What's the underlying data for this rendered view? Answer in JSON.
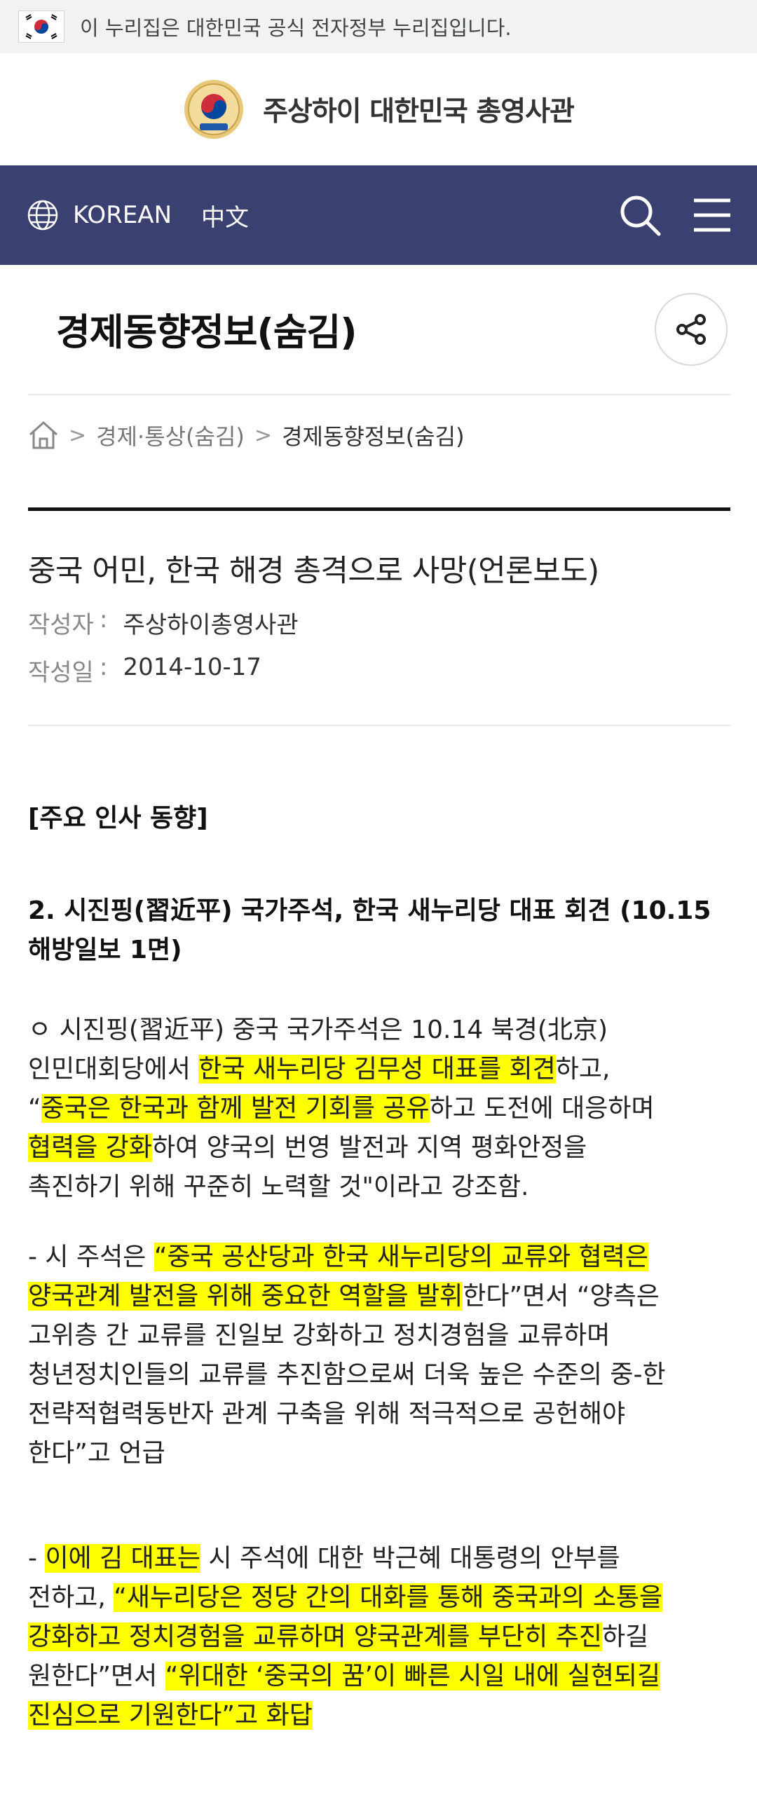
{
  "gov_banner": {
    "text": "이 누리집은 대한민국 공식 전자정부 누리집입니다."
  },
  "header": {
    "title": "주상하이 대한민국 총영사관"
  },
  "nav": {
    "lang_korean": "KOREAN",
    "lang_chinese": "中文"
  },
  "page": {
    "title": "경제동향정보(숨김)"
  },
  "breadcrumb": {
    "items": [
      "경제·통상(숨김)",
      "경제동향정보(숨김)"
    ]
  },
  "post": {
    "title": "중국 어민, 한국 해경 총격으로 사망(언론보도)",
    "author_label": "작성자",
    "author": "주상하이총영사관",
    "date_label": "작성일",
    "date": "2014-10-17"
  },
  "article": {
    "section": "[주요 인사 동향]",
    "heading_1": "2. 시진핑(習近平) 국가주석, 한국 새누리당 대표 회견 (10.15",
    "heading_2": "해방일보 1면)",
    "p1_l1": "ㅇ 시진핑(習近平) 중국 국가주석은 10.14 북경(北京)",
    "p1_l2a": "인민대회당에서 ",
    "p1_l2b": "한국 새누리당 김무성 대표를 회견",
    "p1_l2c": "하고,",
    "p1_l3a": "“",
    "p1_l3b": "중국은 한국과 함께 발전 기회를 공유",
    "p1_l3c": "하고 도전에 대응하며",
    "p1_l4a": "협력을 강화",
    "p1_l4b": "하여 양국의 번영 발전과 지역 평화안정을",
    "p1_l5": "촉진하기 위해 꾸준히 노력할 것\"이라고 강조함.",
    "p2_l1a": "- 시 주석은 ",
    "p2_l1b": "“중국 공산당과 한국 새누리당의 교류와 협력은",
    "p2_l2a": "양국관계 발전을 위해 중요한 역할을 발휘",
    "p2_l2b": "한다”면서 “양측은",
    "p2_l3": "고위층 간 교류를 진일보 강화하고 정치경험을 교류하며",
    "p2_l4": "청년정치인들의 교류를 추진함으로써 더욱 높은 수준의 중-한",
    "p2_l5": "전략적협력동반자 관계 구축을 위해 적극적으로 공헌해야",
    "p2_l6": "한다”고 언급",
    "p3_l1a": "- ",
    "p3_l1b": "이에 김 대표는",
    "p3_l1c": " 시 주석에 대한 박근혜 대통령의 안부를",
    "p3_l2a": "전하고, ",
    "p3_l2b": "“새누리당은 정당 간의 대화를 통해 중국과의 소통을",
    "p3_l3a": "강화하고 정치경험을 교류하며 양국관계를 부단히 추진",
    "p3_l3b": "하길",
    "p3_l4a": "원한다”면서 ",
    "p3_l4b": "“위대한 ‘중국의 꿈’이 빠른 시일 내에 실현되길",
    "p3_l5": "진심으로 기원한다”고 화답"
  },
  "colors": {
    "nav_bg": "#3a4070",
    "highlight": "#ffff00",
    "gov_bar_bg": "#f1f2f4"
  },
  "icons": [
    "korea-flag-icon",
    "emblem-icon",
    "globe-icon",
    "search-icon",
    "menu-icon",
    "share-icon",
    "home-icon"
  ]
}
